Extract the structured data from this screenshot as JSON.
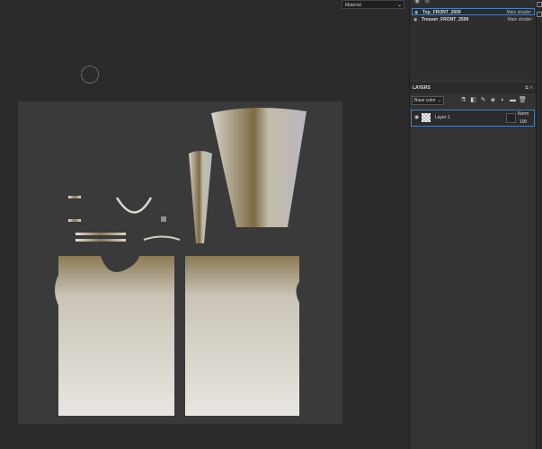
{
  "viewport": {
    "material_dropdown": "Material"
  },
  "texture_sets": [
    {
      "name": "Top_FRONT_2609",
      "shader": "Main shader",
      "selected": true
    },
    {
      "name": "Trouser_FRONT_2599",
      "shader": "Main shader",
      "selected": false
    }
  ],
  "layers_panel": {
    "title": "LAYERS",
    "channel": "Base color",
    "layer": {
      "name": "Layer 1",
      "blend_mode": "Norm",
      "opacity": "100"
    }
  },
  "colors": {
    "accent": "#4a7fb8",
    "panel_bg": "#333333",
    "viewport_bg": "#2b2b2b",
    "canvas_bg": "#3a3a3a"
  }
}
